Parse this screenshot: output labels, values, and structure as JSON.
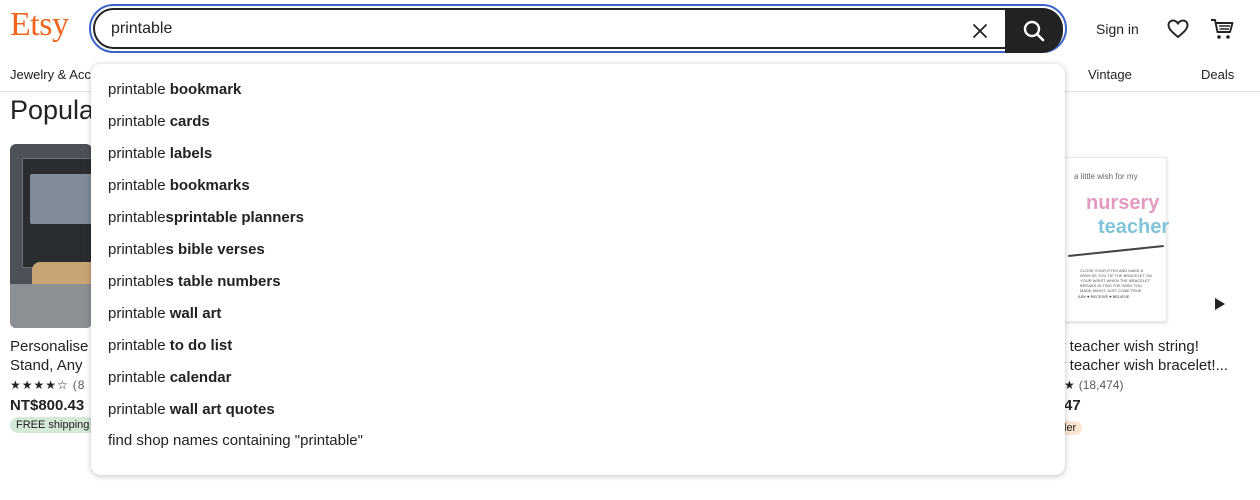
{
  "header": {
    "logo": "Etsy",
    "search": {
      "value": "printable",
      "placeholder": ""
    },
    "sign_in": "Sign in"
  },
  "nav": {
    "items": [
      "Jewelry & Acc",
      "Vintage",
      "Deals"
    ]
  },
  "page": {
    "section_title": "Popula",
    "left_card": {
      "title_line1": "Personalise",
      "title_line2": "Stand, Any",
      "stars": "★★★★☆",
      "review_count": "(8",
      "price": "NT$800.43",
      "badge": "FREE shipping"
    },
    "right_card": {
      "image_small": "a little wish for my",
      "image_big1": "nursery",
      "image_big2": "teacher",
      "image_text": "CLOSE YOUR EYES AND MAKE A WISH AS YOU TIE THE BRACELET ON YOUR WRIST WHEN THE BRACELET BREAKS IN TWO THE WISH YOU MADE MIGHT JUST COME TRUE",
      "image_footer": "ASK ♥ RECEIVE ♥ BELIEVE",
      "title_line1": "y teacher wish string!",
      "title_line2": "y teacher wish bracelet!...",
      "stars": "★",
      "review_count": "(18,474)",
      "price": "47",
      "badge": "ler"
    }
  },
  "dropdown": {
    "typed": "printable",
    "suggestions": [
      {
        "typed": "printable",
        "rest": " bookmark"
      },
      {
        "typed": "printable",
        "rest": " cards"
      },
      {
        "typed": "printable",
        "rest": " labels"
      },
      {
        "typed": "printable",
        "rest": " bookmarks"
      },
      {
        "typed": "printable",
        "rest": "sprintable planners"
      },
      {
        "typed": "printable",
        "rest": "s bible verses"
      },
      {
        "typed": "printable",
        "rest": "s table numbers"
      },
      {
        "typed": "printable",
        "rest": " wall art"
      },
      {
        "typed": "printable",
        "rest": " to do list"
      },
      {
        "typed": "printable",
        "rest": " calendar"
      },
      {
        "typed": "printable",
        "rest": " wall art quotes"
      }
    ],
    "shop_search": "find shop names containing \"printable\""
  },
  "colors": {
    "brand": "#f1641e",
    "focus_ring": "#3b63c8",
    "search_button": "#222222",
    "free_shipping_bg": "#d4e9d7",
    "bestseller_bg": "#fbe5cf"
  },
  "icons": [
    "close-icon",
    "search-icon",
    "heart-icon",
    "cart-icon",
    "play-icon"
  ]
}
